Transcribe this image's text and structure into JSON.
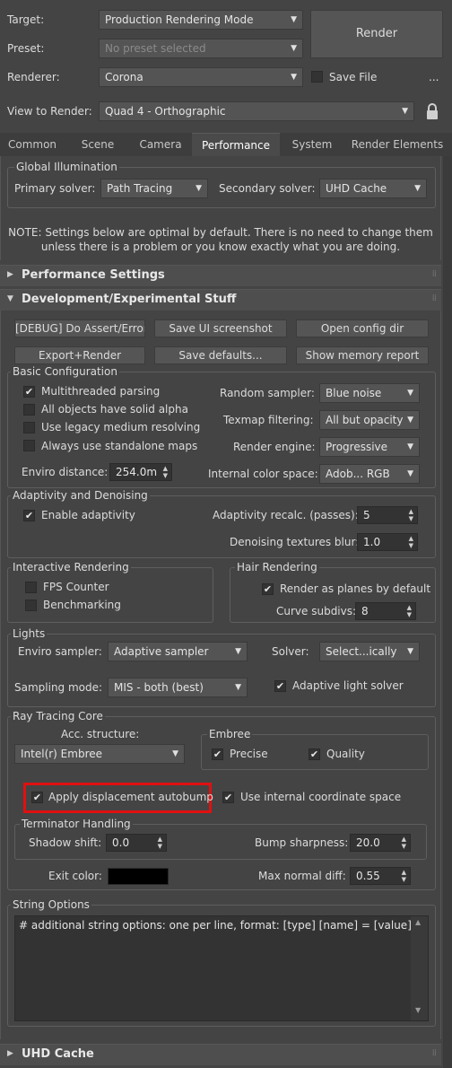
{
  "header": {
    "target_label": "Target:",
    "target_value": "Production Rendering Mode",
    "preset_label": "Preset:",
    "preset_value": "No preset selected",
    "renderer_label": "Renderer:",
    "renderer_value": "Corona",
    "render_button": "Render",
    "save_file_label": "Save File",
    "save_file_checked": false,
    "more_button": "...",
    "view_label": "View to Render:",
    "view_value": "Quad 4 - Orthographic",
    "lock_icon": "lock-icon"
  },
  "tabs": [
    "Common",
    "Scene",
    "Camera",
    "Performance",
    "System",
    "Render Elements"
  ],
  "active_tab": "Performance",
  "global_illumination": {
    "title": "Global Illumination",
    "primary_label": "Primary solver:",
    "primary_value": "Path Tracing",
    "secondary_label": "Secondary solver:",
    "secondary_value": "UHD Cache"
  },
  "note": {
    "line1": "NOTE: Settings below are optimal by default. There is no need to change them",
    "line2": "unless there is a problem or you know exactly what you are doing."
  },
  "rollouts": {
    "performance": "Performance Settings",
    "development": "Development/Experimental Stuff",
    "uhd": "UHD Cache"
  },
  "dev_buttons": {
    "debug_assert": "[DEBUG] Do Assert/Error",
    "save_ui": "Save UI screenshot",
    "open_config": "Open config dir",
    "export_render": "Export+Render",
    "save_defaults": "Save defaults...",
    "show_memory": "Show memory report"
  },
  "basic": {
    "title": "Basic Configuration",
    "multithreaded": "Multithreaded parsing",
    "multithreaded_checked": true,
    "solid_alpha": "All objects have solid alpha",
    "legacy_medium": "Use legacy medium resolving",
    "standalone_maps": "Always use standalone maps",
    "enviro_distance_label": "Enviro distance:",
    "enviro_distance_value": "254.0m",
    "random_sampler_label": "Random sampler:",
    "random_sampler_value": "Blue noise",
    "texmap_label": "Texmap filtering:",
    "texmap_value": "All but opacity",
    "engine_label": "Render engine:",
    "engine_value": "Progressive",
    "color_space_label": "Internal color space:",
    "color_space_value": "Adob... RGB"
  },
  "adaptivity": {
    "title": "Adaptivity and Denoising",
    "enable_label": "Enable adaptivity",
    "enable_checked": true,
    "recalc_label": "Adaptivity recalc. (passes):",
    "recalc_value": "5",
    "blur_label": "Denoising textures blur:",
    "blur_value": "1.0"
  },
  "interactive": {
    "title": "Interactive Rendering",
    "fps_label": "FPS Counter",
    "bench_label": "Benchmarking"
  },
  "hair": {
    "title": "Hair Rendering",
    "planes_label": "Render as planes by default",
    "planes_checked": true,
    "subdivs_label": "Curve subdivs:",
    "subdivs_value": "8"
  },
  "lights": {
    "title": "Lights",
    "enviro_sampler_label": "Enviro sampler:",
    "enviro_sampler_value": "Adaptive sampler",
    "solver_label": "Solver:",
    "solver_value": "Select...ically",
    "sampling_label": "Sampling mode:",
    "sampling_value": "MIS - both (best)",
    "adaptive_solver_label": "Adaptive light solver",
    "adaptive_solver_checked": true
  },
  "ray_tracing": {
    "title": "Ray Tracing Core",
    "acc_label": "Acc. structure:",
    "acc_value": "Intel(r) Embree",
    "embree_title": "Embree",
    "precise_label": "Precise",
    "quality_label": "Quality",
    "autobump_label": "Apply displacement autobump",
    "internal_coord_label": "Use internal coordinate space"
  },
  "terminator": {
    "title": "Terminator Handling",
    "shadow_label": "Shadow shift:",
    "shadow_value": "0.0",
    "bump_label": "Bump sharpness:",
    "bump_value": "20.0",
    "exit_color_label": "Exit color:",
    "exit_color": "#000000",
    "max_normal_label": "Max normal diff:",
    "max_normal_value": "0.55"
  },
  "string_options": {
    "title": "String Options",
    "text": "# additional string options: one per line, format: [type] [name] = [value]"
  },
  "colors": {
    "background": "#444444",
    "highlight": "#e01010",
    "field": "#333333",
    "combo": "#545454"
  }
}
